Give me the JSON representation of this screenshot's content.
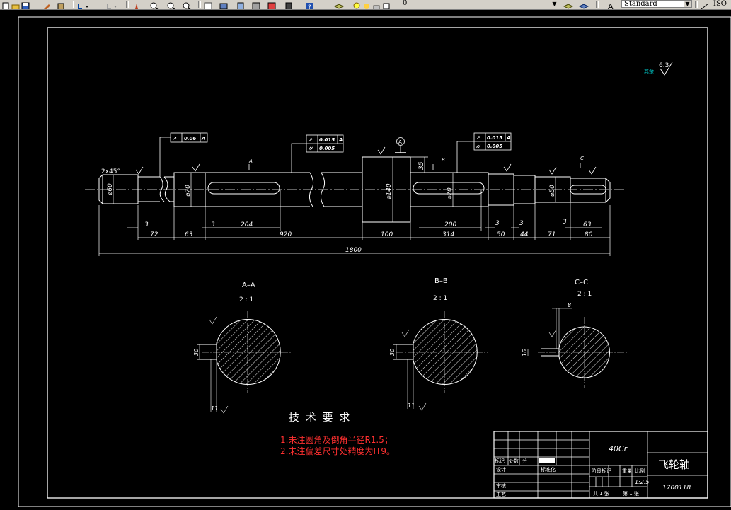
{
  "toolbar": {
    "layer_value": "0",
    "style_value": "Standard",
    "iso_label": "ISO"
  },
  "drawing": {
    "roughness_label": "其余",
    "roughness_value": "6.3",
    "chamfer_note": "2x45°",
    "datum_label": "A",
    "gdt": [
      {
        "symbol": "↗",
        "value": "0.06",
        "datum": "A"
      },
      {
        "symbol": "↗",
        "value": "0.015",
        "datum": "A"
      },
      {
        "symbol": "⌭",
        "value": "0.005",
        "datum": ""
      },
      {
        "symbol": "↗",
        "value": "0.015",
        "datum": "A"
      },
      {
        "symbol": "⌭",
        "value": "0.005",
        "datum": ""
      }
    ],
    "dims": {
      "d72": "72",
      "d63": "63",
      "d204": "204",
      "d920": "920",
      "d100": "100",
      "d200": "200",
      "d314": "314",
      "d50": "50",
      "d44": "44",
      "d71": "71",
      "d80": "80",
      "d63b": "63",
      "d1800": "1800",
      "d3": "3",
      "d35": "35",
      "dia140": "⌀140",
      "dia70": "⌀70",
      "dia50": "⌀50",
      "dia60": "⌀60"
    },
    "sections": [
      {
        "title": "A–A",
        "scale": "2 : 1",
        "d30": "30",
        "d11": "11"
      },
      {
        "title": "B–B",
        "scale": "2 : 1",
        "d30": "30",
        "d11": "11"
      },
      {
        "title": "C–C",
        "scale": "2 : 1",
        "d16": "16",
        "d8": "8"
      }
    ],
    "cut_labels": [
      "A",
      "B",
      "C"
    ],
    "requirements": {
      "heading": "技 术 要 求",
      "items": [
        "1.未注圆角及倒角半径R1.5；",
        "2.未注偏差尺寸处精度为IT9。"
      ]
    },
    "title_block": {
      "material": "40Cr",
      "part_name": "飞轮轴",
      "drawing_no": "1700118",
      "scale": "1:2.5",
      "labels": {
        "marks": "标记",
        "count": "处数",
        "zone": "分",
        "design": "设计",
        "standard": "标准化",
        "review": "审核",
        "process": "工艺",
        "stage": "阶段标记",
        "weight": "重量",
        "ratio": "比例",
        "total": "共 1 张",
        "sheet": "第 1 张"
      }
    }
  }
}
